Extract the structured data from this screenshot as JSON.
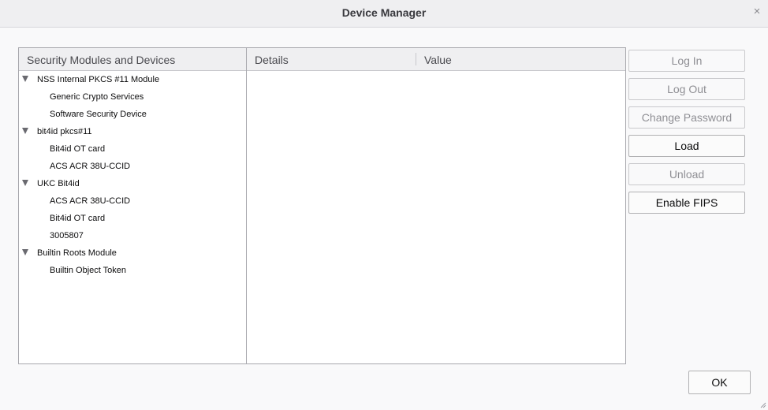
{
  "window": {
    "title": "Device Manager",
    "close_glyph": "×"
  },
  "tree": {
    "header": "Security Modules and Devices",
    "rows": [
      {
        "label": "NSS Internal PKCS #11 Module",
        "kind": "module"
      },
      {
        "label": "Generic Crypto Services",
        "kind": "device"
      },
      {
        "label": "Software Security Device",
        "kind": "device"
      },
      {
        "label": "bit4id pkcs#11",
        "kind": "module"
      },
      {
        "label": "Bit4id OT card",
        "kind": "device"
      },
      {
        "label": "ACS ACR 38U-CCID",
        "kind": "device"
      },
      {
        "label": "UKC Bit4id",
        "kind": "module"
      },
      {
        "label": "ACS ACR 38U-CCID",
        "kind": "device"
      },
      {
        "label": "Bit4id OT card",
        "kind": "device"
      },
      {
        "label": "3005807",
        "kind": "device"
      },
      {
        "label": "Builtin Roots Module",
        "kind": "module"
      },
      {
        "label": "Builtin Object Token",
        "kind": "device"
      }
    ]
  },
  "details": {
    "col_details": "Details",
    "col_value": "Value"
  },
  "buttons": {
    "log_in": "Log In",
    "log_out": "Log Out",
    "change_password": "Change Password",
    "load": "Load",
    "unload": "Unload",
    "enable_fips": "Enable FIPS",
    "ok": "OK"
  }
}
